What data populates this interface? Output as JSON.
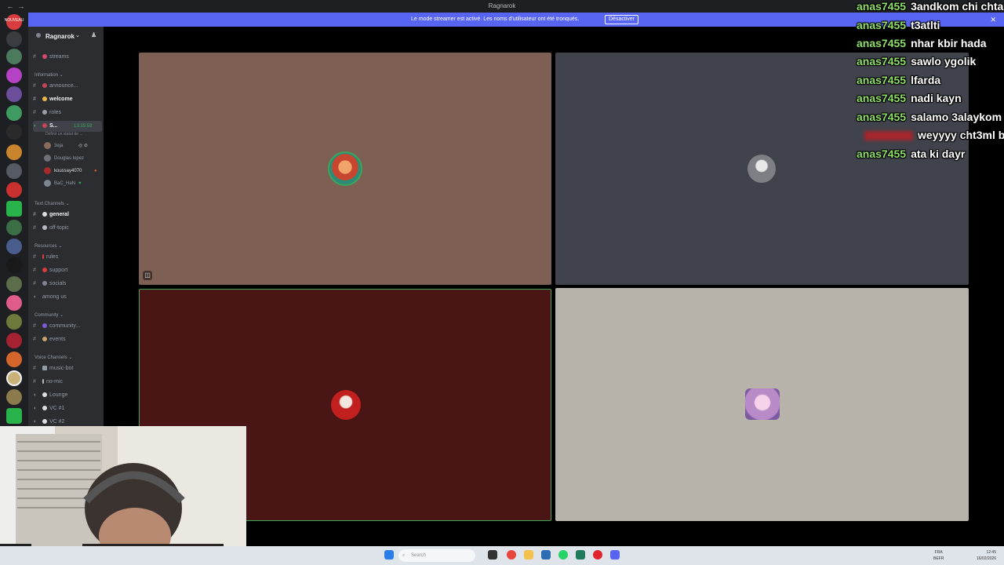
{
  "window": {
    "title": "Ragnarok"
  },
  "banner": {
    "message": "Le mode streamer est activé. Les noms d'utilisateur ont été tronqués.",
    "button_label": "Désactiver"
  },
  "rail": {
    "home_label": "NOUVEAU"
  },
  "sidebar": {
    "server_name": "Ragnarok",
    "top_channels": [
      {
        "label": "streams"
      }
    ],
    "information": {
      "label": "Information",
      "channels": [
        {
          "label": "announce..."
        },
        {
          "label": "welcome"
        },
        {
          "label": "roles"
        }
      ]
    },
    "voice_active": {
      "channel_label": "S...",
      "timer": "13:35:59",
      "status": "Définir un statut de ...",
      "members": [
        {
          "name": "3eja"
        },
        {
          "name": "Douglas lopez"
        },
        {
          "name": "koussay4070"
        },
        {
          "name": "BaC_HaN"
        }
      ]
    },
    "text_channels": {
      "label": "Text Channels",
      "channels": [
        {
          "label": "general"
        },
        {
          "label": "off-topic"
        }
      ]
    },
    "resources": {
      "label": "Resources",
      "channels": [
        {
          "label": "rules"
        },
        {
          "label": "support"
        },
        {
          "label": "socials"
        },
        {
          "label": "among us"
        }
      ]
    },
    "community": {
      "label": "Community",
      "channels": [
        {
          "label": "community..."
        },
        {
          "label": "events"
        }
      ]
    },
    "voice_channels": {
      "label": "Voice Channels",
      "channels": [
        {
          "label": "music-bot"
        },
        {
          "label": "no-mic"
        },
        {
          "label": "Lounge"
        },
        {
          "label": "VC #1"
        },
        {
          "label": "VC #2"
        }
      ]
    }
  },
  "tiles": [
    {
      "name": "tile-1",
      "bg": "#7d5f54"
    },
    {
      "name": "tile-2",
      "bg": "#40434b"
    },
    {
      "name": "tile-3",
      "bg": "#491515"
    },
    {
      "name": "tile-4",
      "bg": "#b7b3ab"
    }
  ],
  "chat": [
    {
      "user": "anas7455",
      "text": "3andkom chi chta"
    },
    {
      "user": "anas7455",
      "text": "t3atlti"
    },
    {
      "user": "anas7455",
      "text": "nhar kbir hada"
    },
    {
      "user": "anas7455",
      "text": "sawlo ygolik"
    },
    {
      "user": "anas7455",
      "text": "lfarda"
    },
    {
      "user": "anas7455",
      "text": "nadi kayn"
    },
    {
      "user": "anas7455",
      "text": "salamo 3alaykom"
    },
    {
      "user": "",
      "text": "weyyyy cht3ml bo"
    },
    {
      "user": "anas7455",
      "text": "ata ki dayr"
    }
  ],
  "taskbar": {
    "search_placeholder": "Search",
    "lang_line1": "FRA",
    "lang_line2": "BEFR",
    "time": "12:45",
    "date": "16/02/2026"
  },
  "colors": {
    "accent": "#5865f2",
    "chat_user": "#8fde6a",
    "speaking_ring": "#3ba55c"
  }
}
